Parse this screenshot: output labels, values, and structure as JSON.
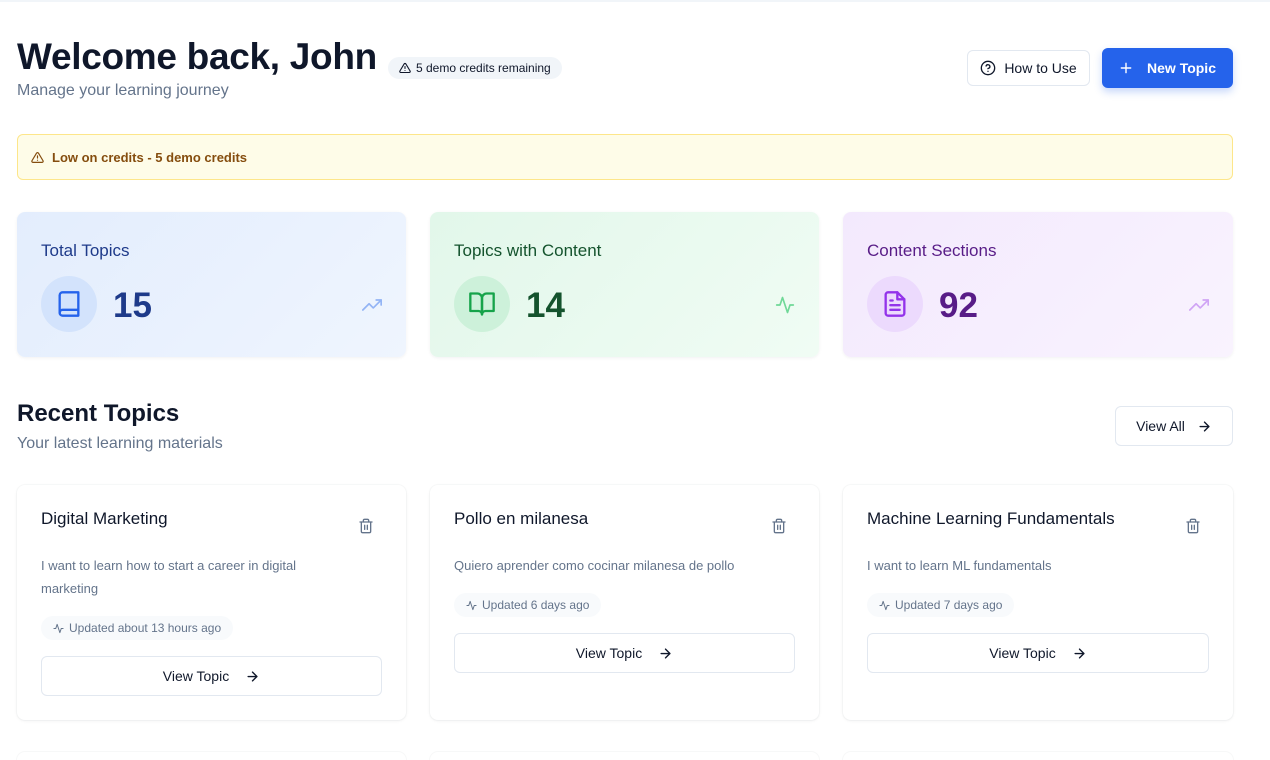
{
  "header": {
    "title": "Welcome back, John",
    "subtitle": "Manage your learning journey",
    "credits_badge": "5 demo credits remaining",
    "how_to_use_label": "How to Use",
    "new_topic_label": "New Topic"
  },
  "alert": {
    "message": "Low on credits - 5 demo credits"
  },
  "stats": [
    {
      "label": "Total Topics",
      "value": "15",
      "icon": "book-icon",
      "trend_icon": "trending-up-icon"
    },
    {
      "label": "Topics with Content",
      "value": "14",
      "icon": "book-open-icon",
      "trend_icon": "activity-icon"
    },
    {
      "label": "Content Sections",
      "value": "92",
      "icon": "file-text-icon",
      "trend_icon": "trending-up-icon"
    }
  ],
  "recent": {
    "title": "Recent Topics",
    "subtitle": "Your latest learning materials",
    "view_all_label": "View All"
  },
  "topics": [
    {
      "title": "Digital Marketing",
      "description": "I want to learn how to start a career in digital marketing",
      "updated": "Updated about 13 hours ago",
      "view_label": "View Topic"
    },
    {
      "title": "Pollo en milanesa",
      "description": "Quiero aprender como cocinar milanesa de pollo",
      "updated": "Updated 6 days ago",
      "view_label": "View Topic"
    },
    {
      "title": "Machine Learning Fundamentals",
      "description": "I want to learn ML fundamentals",
      "updated": "Updated 7 days ago",
      "view_label": "View Topic"
    }
  ],
  "colors": {
    "primary": "#2563eb",
    "blue_text": "#1e3a8a",
    "green_text": "#14532d",
    "purple_text": "#581c87",
    "warning_text": "#854d0e",
    "warning_bg": "#fefce8"
  }
}
